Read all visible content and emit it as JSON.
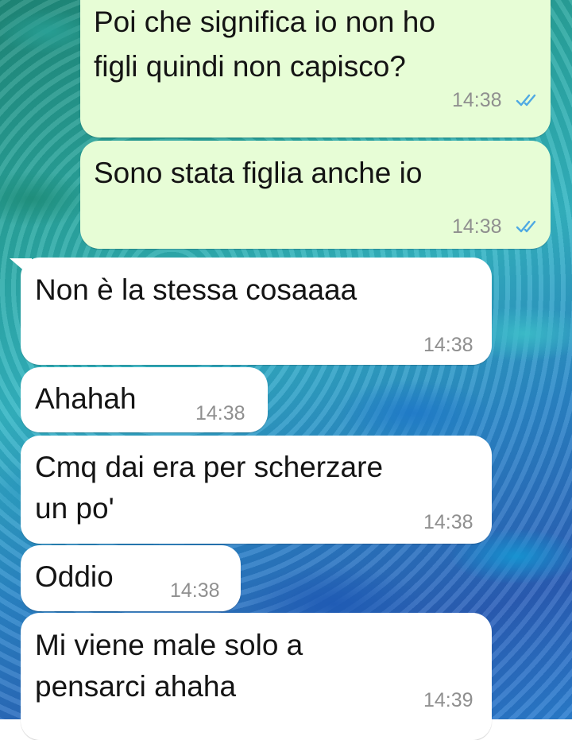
{
  "messages": [
    {
      "direction": "outgoing",
      "lines": [
        "Poi che significa io non ho",
        "figli quindi non capisco?"
      ],
      "time": "14:38",
      "status": "read"
    },
    {
      "direction": "outgoing",
      "lines": [
        "Sono stata figlia anche io"
      ],
      "time": "14:38",
      "status": "read"
    },
    {
      "direction": "incoming",
      "lines": [
        "Non è la stessa cosaaaa"
      ],
      "time": "14:38"
    },
    {
      "direction": "incoming",
      "lines": [
        "Ahahah"
      ],
      "time": "14:38"
    },
    {
      "direction": "incoming",
      "lines": [
        "Cmq dai era per scherzare",
        "un po'"
      ],
      "time": "14:38"
    },
    {
      "direction": "incoming",
      "lines": [
        "Oddio"
      ],
      "time": "14:38"
    },
    {
      "direction": "incoming",
      "lines": [
        "Mi viene male solo a",
        "pensarci ahaha"
      ],
      "time": "14:39"
    }
  ],
  "colors": {
    "outgoing_bubble": "#e7fdd6",
    "incoming_bubble": "#ffffff",
    "read_ticks": "#4fa9e3",
    "timestamp": "#8f8f8f"
  },
  "icons": {
    "read_status": "double-check-icon"
  }
}
